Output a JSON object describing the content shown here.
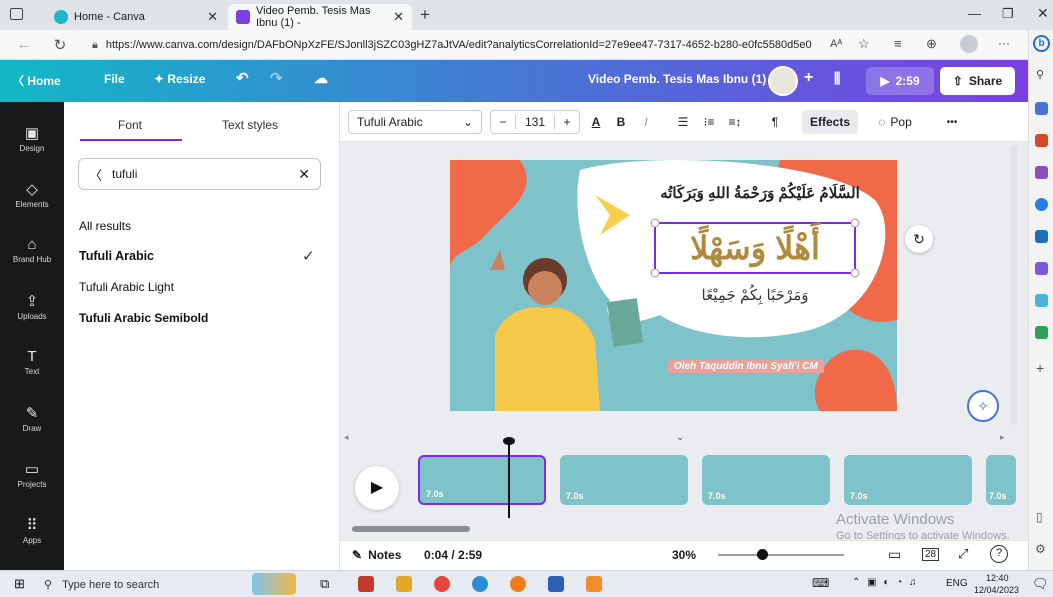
{
  "browser": {
    "tabs": [
      {
        "label": "Home - Canva"
      },
      {
        "label": "Video Pemb. Tesis Mas Ibnu (1) -"
      }
    ],
    "new_tab_label": "+",
    "url": "https://www.canva.com/design/DAFbONpXzFE/SJonll3jSZC03gHZ7aJtVA/edit?analyticsCorrelationId=27e9ee47-7317-4652-b280-e0fc5580d5e0",
    "read_aloud_label": "Aᴬ"
  },
  "header": {
    "home_label": "Home",
    "file_label": "File",
    "resize_label": "Resize",
    "doc_title": "Video Pemb. Tesis Mas Ibnu (1)",
    "present_time": "2:59",
    "share_label": "Share",
    "add_label": "+"
  },
  "rail": {
    "items": [
      {
        "label": "Design",
        "icon": "layout-icon"
      },
      {
        "label": "Elements",
        "icon": "shapes-icon"
      },
      {
        "label": "Brand Hub",
        "icon": "brand-icon"
      },
      {
        "label": "Uploads",
        "icon": "upload-icon"
      },
      {
        "label": "Text",
        "icon": "text-icon"
      },
      {
        "label": "Draw",
        "icon": "pen-icon"
      },
      {
        "label": "Projects",
        "icon": "folder-icon"
      },
      {
        "label": "Apps",
        "icon": "grid-icon"
      }
    ]
  },
  "panel": {
    "tab_font": "Font",
    "tab_text_styles": "Text styles",
    "search_value": "tufuli",
    "results_heading": "All results",
    "fonts": [
      {
        "name": "Tufuli Arabic",
        "selected": true
      },
      {
        "name": "Tufuli Arabic Light",
        "selected": false
      },
      {
        "name": "Tufuli Arabic Semibold",
        "selected": false
      }
    ]
  },
  "toolbar": {
    "font_name": "Tufuli Arabic",
    "font_size": "131",
    "minus": "−",
    "plus": "+",
    "effects_label": "Effects",
    "pop_label": "Pop",
    "more_label": "•••"
  },
  "slide": {
    "salam_text": "السَّلَامُ عَلَيْكُمْ وَرَحْمَةُ اللهِ وَبَرَكَاتُه",
    "ahlan_text": "أَهْلًا وَسَهْلًا",
    "marhaban_text": "وَمَرْحَبًا بِكُمْ جَمِيْعًا",
    "author_text": "Oleh Taquddin Ibnu Syafi'i CM",
    "colors": {
      "bg": "#7ec3c9",
      "blob": "#f06a4a",
      "bubble": "#ffffff",
      "title": "#b08a3c"
    }
  },
  "timeline": {
    "durations": [
      "7.0s",
      "7.0s",
      "7.0s",
      "7.0s",
      "7.0s"
    ],
    "notes_label": "Notes",
    "time_display": "0:04 / 2:59",
    "zoom_label": "30%",
    "page_count": "28"
  },
  "watermark": {
    "line1": "Activate Windows",
    "line2": "Go to Settings to activate Windows."
  },
  "taskbar": {
    "search_placeholder": "Type here to search",
    "lang": "ENG",
    "time": "12:40",
    "date": "12/04/2023"
  }
}
